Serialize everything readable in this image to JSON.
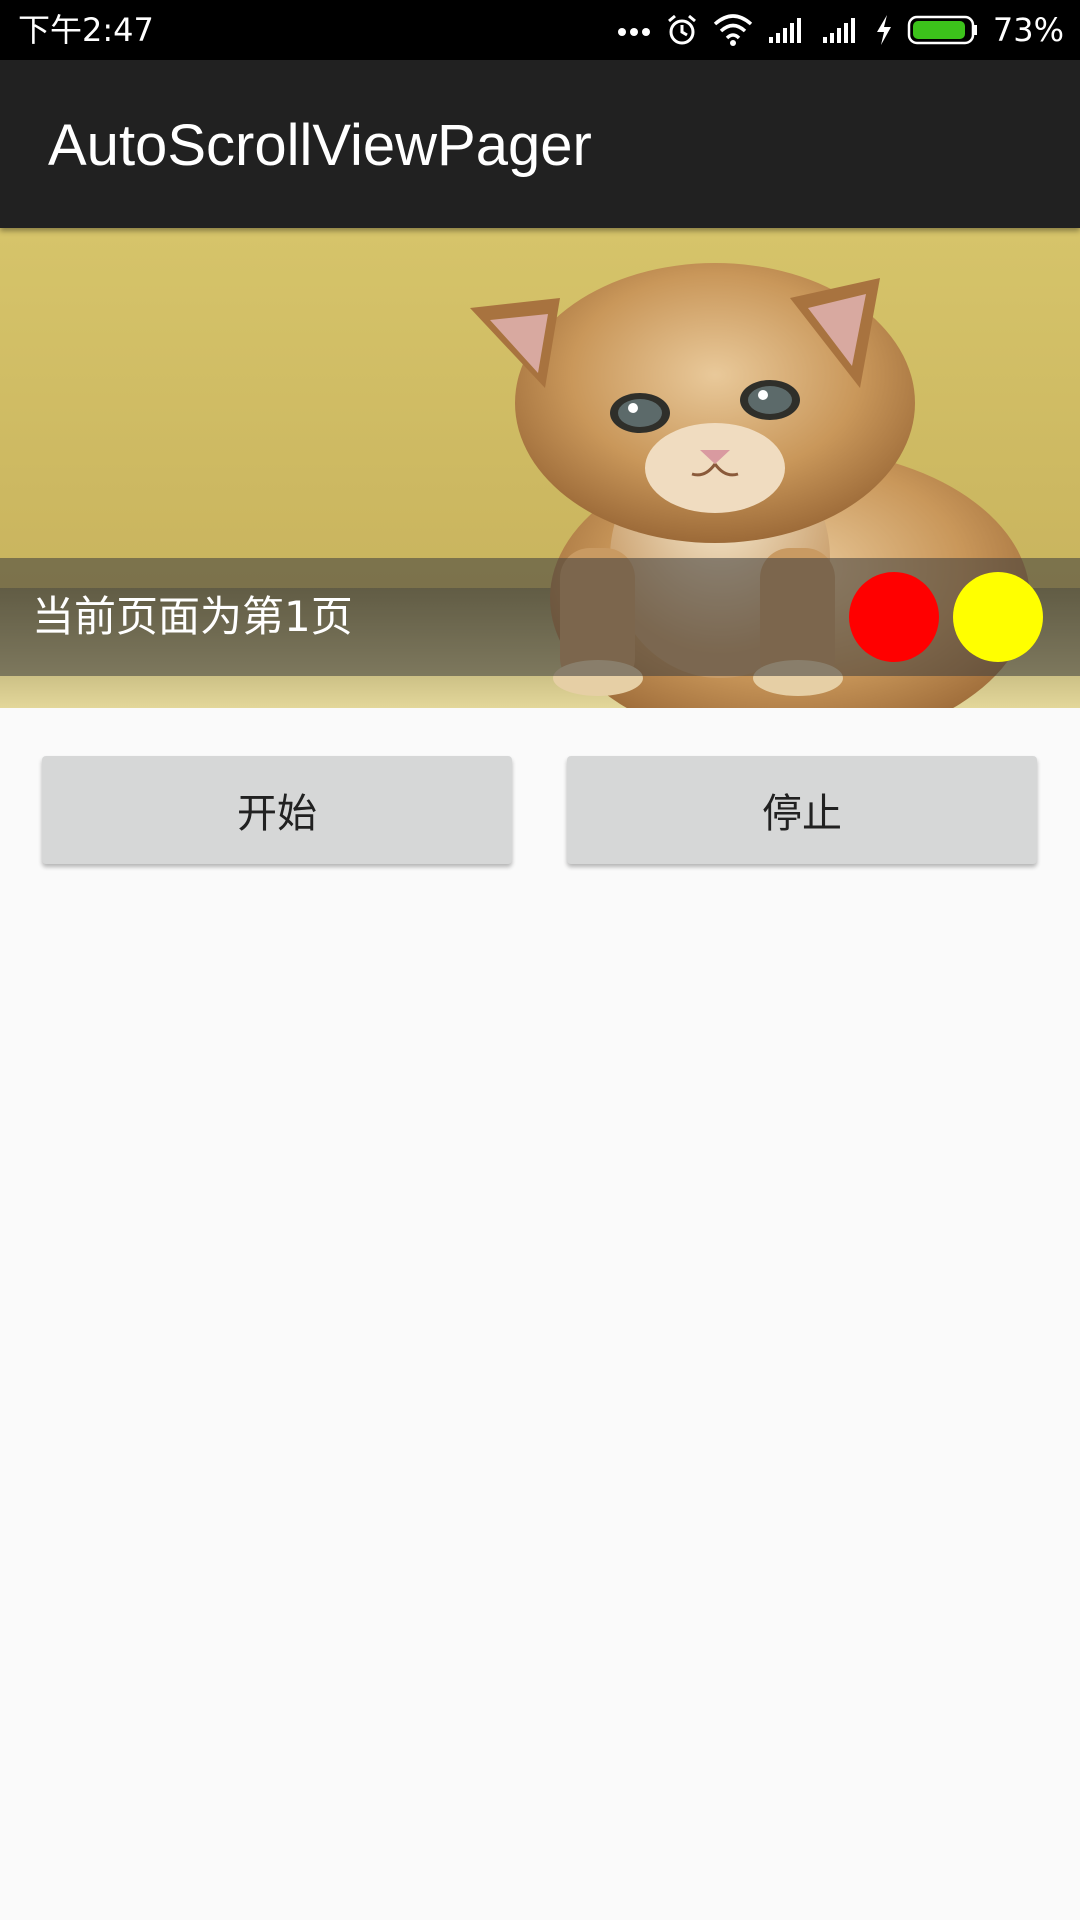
{
  "status_bar": {
    "time": "下午2:47",
    "battery_percent": "73%",
    "icons": [
      "more-dots-icon",
      "alarm-icon",
      "wifi-icon",
      "signal-icon",
      "signal-icon",
      "charging-icon",
      "battery-icon"
    ],
    "battery_color": "#3cc31b"
  },
  "app_bar": {
    "title": "AutoScrollViewPager",
    "background": "#212121"
  },
  "pager": {
    "caption": "当前页面为第1页",
    "indicator_colors": [
      "#ff0000",
      "#ffff00"
    ],
    "image": "kitten-photo"
  },
  "controls": {
    "start_label": "开始",
    "stop_label": "停止"
  }
}
